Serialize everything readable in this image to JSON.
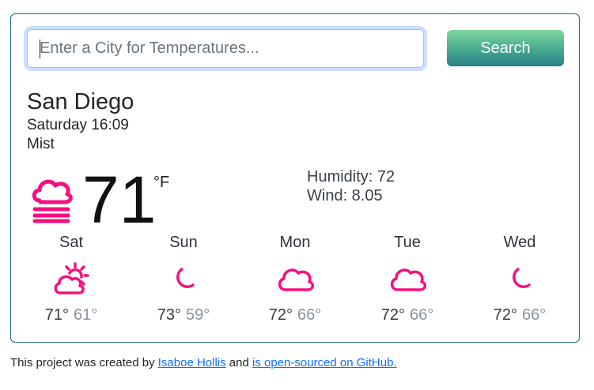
{
  "search": {
    "placeholder": "Enter a City for Temperatures...",
    "value": "",
    "button_label": "Search"
  },
  "current": {
    "city": "San Diego",
    "datetime": "Saturday 16:09",
    "description": "Mist",
    "temperature": "71",
    "unit": "°F",
    "icon": "mist-icon",
    "humidity": "Humidity: 72",
    "wind": "Wind: 8.05"
  },
  "forecast": [
    {
      "day": "Sat",
      "max": "71°",
      "min": "61°",
      "icon": "partly-sunny-icon"
    },
    {
      "day": "Sun",
      "max": "73°",
      "min": "59°",
      "icon": "moon-icon"
    },
    {
      "day": "Mon",
      "max": "72°",
      "min": "66°",
      "icon": "cloud-icon"
    },
    {
      "day": "Tue",
      "max": "72°",
      "min": "66°",
      "icon": "cloud-icon"
    },
    {
      "day": "Wed",
      "max": "72°",
      "min": "66°",
      "icon": "moon-icon"
    }
  ],
  "footer": {
    "prefix": "This project was created by ",
    "author_link": "Isaboe Hollis",
    "middle": " and ",
    "repo_link": "is open-sourced on GitHub."
  },
  "colors": {
    "icon": "#f5107f",
    "border": "#1d6b80",
    "button_top": "#7fd5a0",
    "button_bottom": "#2b7e86",
    "link": "#0d6efd"
  }
}
